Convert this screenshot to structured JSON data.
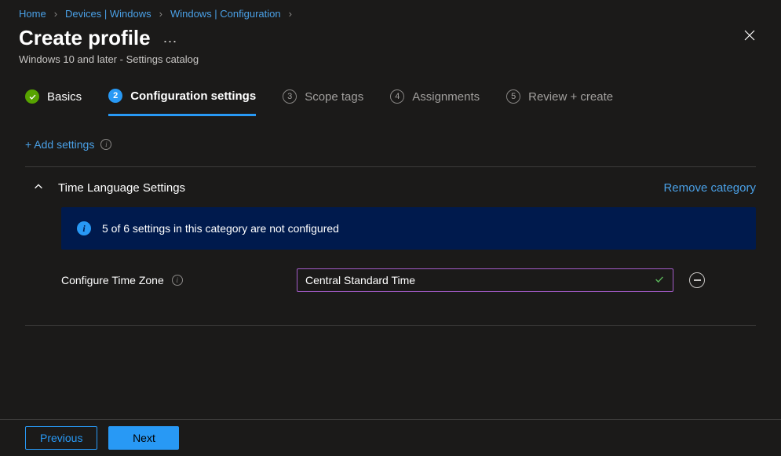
{
  "breadcrumb": {
    "items": [
      {
        "label": "Home"
      },
      {
        "label": "Devices | Windows"
      },
      {
        "label": "Windows | Configuration"
      }
    ]
  },
  "header": {
    "title": "Create profile",
    "subtitle": "Windows 10 and later - Settings catalog"
  },
  "steps": {
    "items": [
      {
        "num": "1",
        "label": "Basics",
        "state": "done"
      },
      {
        "num": "2",
        "label": "Configuration settings",
        "state": "active"
      },
      {
        "num": "3",
        "label": "Scope tags",
        "state": "future"
      },
      {
        "num": "4",
        "label": "Assignments",
        "state": "future"
      },
      {
        "num": "5",
        "label": "Review + create",
        "state": "future"
      }
    ]
  },
  "toolbar": {
    "add_settings": "+ Add settings"
  },
  "category": {
    "title": "Time Language Settings",
    "remove": "Remove category",
    "banner": "5 of 6 settings in this category are not configured",
    "setting_label": "Configure Time Zone",
    "setting_value": "Central Standard Time"
  },
  "footer": {
    "previous": "Previous",
    "next": "Next"
  }
}
